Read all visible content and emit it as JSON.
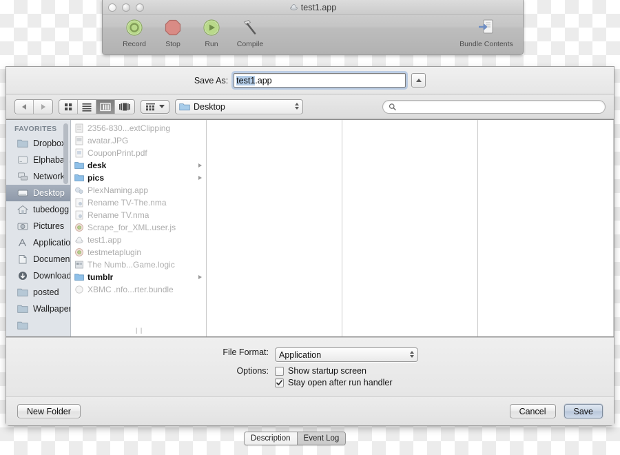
{
  "app_window": {
    "title": "test1.app",
    "traffic_lights": [
      "close",
      "minimize",
      "zoom"
    ],
    "toolbar": [
      {
        "label": "Record",
        "icon": "record-icon"
      },
      {
        "label": "Stop",
        "icon": "stop-icon"
      },
      {
        "label": "Run",
        "icon": "run-icon"
      },
      {
        "label": "Compile",
        "icon": "compile-hammer-icon"
      }
    ],
    "toolbar_right": {
      "label": "Bundle Contents",
      "icon": "bundle-contents-icon"
    }
  },
  "sheet": {
    "save_as": {
      "label": "Save As:",
      "value_selected": "test1",
      "value_rest": ".app",
      "full_value": "test1.app",
      "disclosure_icon": "triangle-up-icon"
    },
    "nav": {
      "back_icon": "back-arrow-icon",
      "forward_icon": "forward-arrow-icon",
      "view_modes": [
        {
          "name": "icon-view",
          "icon": "grid-icon",
          "selected": false
        },
        {
          "name": "list-view",
          "icon": "list-icon",
          "selected": false
        },
        {
          "name": "column-view",
          "icon": "columns-icon",
          "selected": true
        },
        {
          "name": "coverflow-view",
          "icon": "coverflow-icon",
          "selected": false
        }
      ],
      "action_menu": {
        "icon": "gear-grid-icon",
        "chevron": "chevron-down-icon"
      },
      "path_popup": {
        "value": "Desktop",
        "icon": "folder-icon"
      },
      "search": {
        "placeholder": "",
        "value": "",
        "icon": "search-icon"
      }
    },
    "sidebar": {
      "header": "FAVORITES",
      "items": [
        {
          "label": "Dropbox",
          "icon": "folder-icon",
          "selected": false,
          "eject": false
        },
        {
          "label": "Elphaba",
          "icon": "disk-icon",
          "selected": false,
          "eject": true
        },
        {
          "label": "Network",
          "icon": "network-icon",
          "selected": false,
          "eject": false
        },
        {
          "label": "Desktop",
          "icon": "desktop-icon",
          "selected": true,
          "eject": false
        },
        {
          "label": "tubedogg",
          "icon": "home-icon",
          "selected": false,
          "eject": false
        },
        {
          "label": "Pictures",
          "icon": "pictures-icon",
          "selected": false,
          "eject": false
        },
        {
          "label": "Applications",
          "icon": "applications-icon",
          "selected": false,
          "eject": false
        },
        {
          "label": "Documents",
          "icon": "documents-icon",
          "selected": false,
          "eject": false
        },
        {
          "label": "Downloads",
          "icon": "downloads-icon",
          "selected": false,
          "eject": false
        },
        {
          "label": "posted",
          "icon": "folder-icon",
          "selected": false,
          "eject": false
        },
        {
          "label": "Wallpapers",
          "icon": "folder-icon",
          "selected": false,
          "eject": false
        }
      ]
    },
    "file_list": [
      {
        "name": "2356-830...extClipping",
        "icon": "clipping-icon",
        "kind": "file",
        "disclosure": false
      },
      {
        "name": "avatar.JPG",
        "icon": "image-icon",
        "kind": "file",
        "disclosure": false
      },
      {
        "name": "CouponPrint.pdf",
        "icon": "pdf-icon",
        "kind": "file",
        "disclosure": false
      },
      {
        "name": "desk",
        "icon": "folder-icon",
        "kind": "folder",
        "disclosure": true
      },
      {
        "name": "pics",
        "icon": "folder-icon",
        "kind": "folder",
        "disclosure": true
      },
      {
        "name": "PlexNaming.app",
        "icon": "app-icon",
        "kind": "file",
        "disclosure": false
      },
      {
        "name": "Rename TV-The.nma",
        "icon": "script-icon",
        "kind": "file",
        "disclosure": false
      },
      {
        "name": "Rename TV.nma",
        "icon": "script-icon",
        "kind": "file",
        "disclosure": false
      },
      {
        "name": "Scrape_for_XML.user.js",
        "icon": "js-icon",
        "kind": "file",
        "disclosure": false
      },
      {
        "name": "test1.app",
        "icon": "applescript-icon",
        "kind": "file",
        "disclosure": false
      },
      {
        "name": "testmetaplugin",
        "icon": "js-icon",
        "kind": "file",
        "disclosure": false
      },
      {
        "name": "The Numb...Game.logic",
        "icon": "logic-icon",
        "kind": "file",
        "disclosure": false
      },
      {
        "name": "tumblr",
        "icon": "folder-icon",
        "kind": "folder",
        "disclosure": true
      },
      {
        "name": "XBMC .nfo...rter.bundle",
        "icon": "bundle-icon",
        "kind": "file",
        "disclosure": false
      }
    ],
    "options": {
      "file_format_label": "File Format:",
      "file_format_value": "Application",
      "options_label": "Options:",
      "checkboxes": [
        {
          "label": "Show startup screen",
          "checked": false
        },
        {
          "label": "Stay open after run handler",
          "checked": true
        }
      ]
    },
    "buttons": {
      "new_folder": "New Folder",
      "cancel": "Cancel",
      "save": "Save"
    }
  },
  "bottom_tabs": [
    {
      "label": "Description",
      "selected": true
    },
    {
      "label": "Event Log",
      "selected": false
    }
  ],
  "colors": {
    "selection_blue": "#b4cde8",
    "sidebar_bg": "#e0e4e9",
    "sidebar_selected": "#8e99a9",
    "default_button": "#c7d3e3",
    "folder_blue": "#8fc0e8"
  }
}
